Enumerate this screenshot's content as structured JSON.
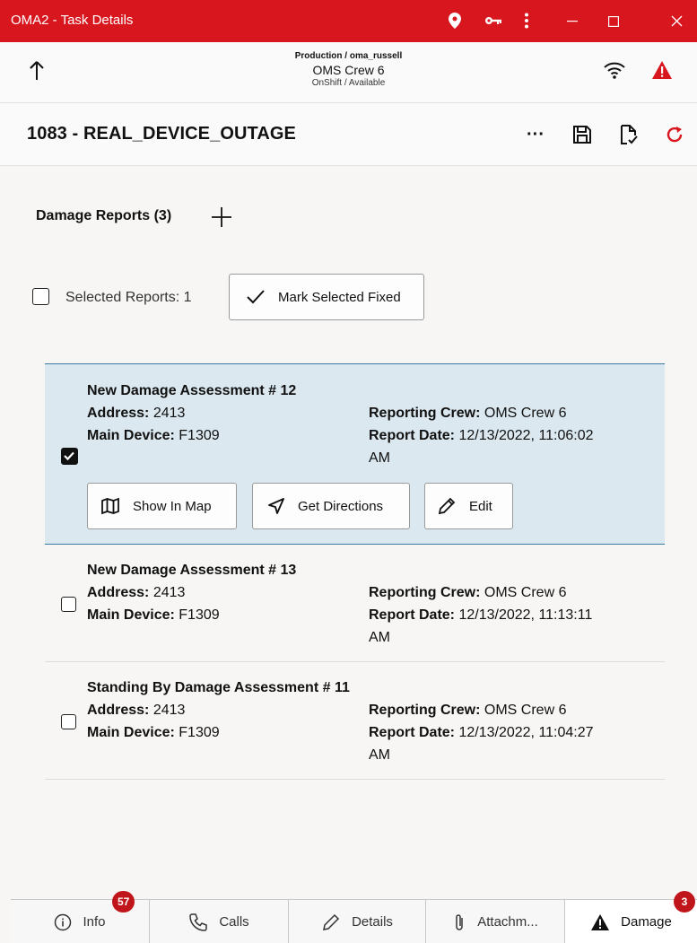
{
  "window": {
    "title": "OMA2 - Task Details",
    "controls": {
      "minimize": "—",
      "maximize": "☐",
      "close": "✕"
    }
  },
  "header": {
    "environment": "Production / oma_russell",
    "crew": "OMS Crew 6",
    "status": "OnShift / Available"
  },
  "task": {
    "title": "1083 - REAL_DEVICE_OUTAGE",
    "more_label": "···"
  },
  "damage": {
    "section_title": "Damage Reports (3)",
    "selected_label": "Selected Reports: 1",
    "mark_fixed_label": "Mark Selected Fixed",
    "reports": [
      {
        "title": "New Damage Assessment # 12",
        "address_label": "Address:",
        "address": "2413",
        "device_label": "Main Device:",
        "device": "F1309",
        "crew_label": "Reporting Crew:",
        "crew": "OMS Crew 6",
        "date_label": "Report Date:",
        "date": "12/13/2022, 11:06:02",
        "date_suffix": "AM",
        "checked": true
      },
      {
        "title": "New Damage Assessment # 13",
        "address_label": "Address:",
        "address": "2413",
        "device_label": "Main Device:",
        "device": "F1309",
        "crew_label": "Reporting Crew:",
        "crew": "OMS Crew 6",
        "date_label": "Report Date:",
        "date": "12/13/2022, 11:13:11",
        "date_suffix": "AM",
        "checked": false
      },
      {
        "title": "Standing By Damage Assessment # 11",
        "address_label": "Address:",
        "address": "2413",
        "device_label": "Main Device:",
        "device": "F1309",
        "crew_label": "Reporting Crew:",
        "crew": "OMS Crew 6",
        "date_label": "Report Date:",
        "date": "12/13/2022, 11:04:27",
        "date_suffix": "AM",
        "checked": false
      }
    ],
    "actions": {
      "show_in_map": "Show In Map",
      "get_directions": "Get Directions",
      "edit": "Edit"
    }
  },
  "tabs": [
    {
      "label": "Info",
      "badge": "57",
      "icon": "info-icon"
    },
    {
      "label": "Calls",
      "icon": "phone-icon"
    },
    {
      "label": "Details",
      "icon": "pencil-icon"
    },
    {
      "label": "Attachm...",
      "icon": "paperclip-icon"
    },
    {
      "label": "Damage",
      "badge": "3",
      "icon": "warning-icon",
      "active": true
    }
  ],
  "colors": {
    "titlebar": "#d8161e",
    "selected_card": "#dbe8ef",
    "badge": "#c0151a",
    "warning": "#d8161e"
  }
}
